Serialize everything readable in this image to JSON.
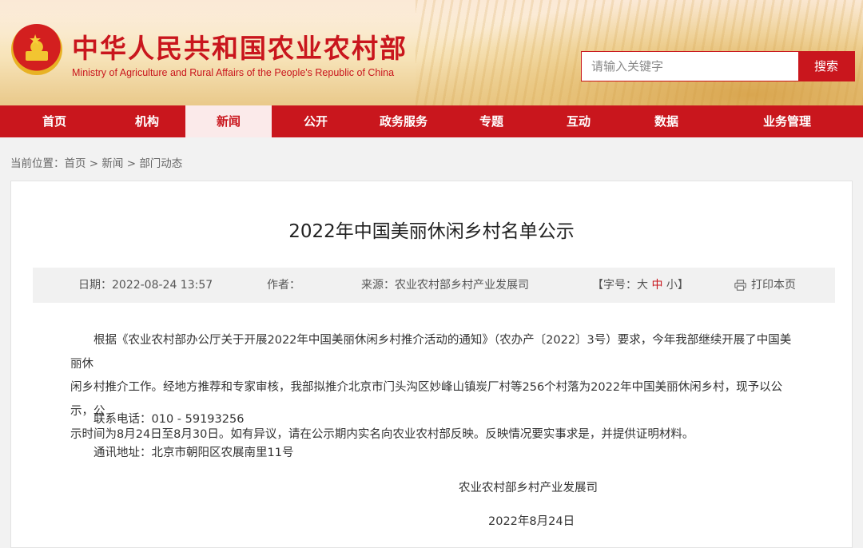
{
  "header": {
    "title_zh": "中华人民共和国农业农村部",
    "title_en": "Ministry of Agriculture and Rural Affairs of the People's Republic of China",
    "search_placeholder": "请输入关键字",
    "search_button": "搜索"
  },
  "nav": [
    {
      "label": "首页",
      "active": false
    },
    {
      "label": "机构",
      "active": false
    },
    {
      "label": "新闻",
      "active": true
    },
    {
      "label": "公开",
      "active": false
    },
    {
      "label": "政务服务",
      "active": false
    },
    {
      "label": "专题",
      "active": false
    },
    {
      "label": "互动",
      "active": false
    },
    {
      "label": "数据",
      "active": false
    },
    {
      "label": "业务管理",
      "active": false
    }
  ],
  "breadcrumb": {
    "prefix": "当前位置：",
    "items": [
      "首页",
      "新闻",
      "部门动态"
    ],
    "sep": " > "
  },
  "article": {
    "title": "2022年中国美丽休闲乡村名单公示",
    "date": "日期：2022-08-24 13:57",
    "author": "作者：",
    "source": "来源：农业农村部乡村产业发展司",
    "font_size_prefix": "【字号：",
    "font_size_large": "大",
    "font_size_medium": "中",
    "font_size_small": "小",
    "font_size_suffix": "】",
    "print": "打印本页",
    "body_lines": [
      "根据《农业农村部办公厅关于开展2022年中国美丽休闲乡村推介活动的通知》（农办产〔2022〕3号）要求，今年我部继续开展了中国美丽休",
      "闲乡村推介工作。经地方推荐和专家审核，我部拟推介北京市门头沟区妙峰山镇炭厂村等256个村落为2022年中国美丽休闲乡村，现予以公示，公",
      "示时间为8月24日至8月30日。如有异议，请在公示期内实名向农业农村部反映。反映情况要实事求是，并提供证明材料。"
    ],
    "phone": "联系电话：010 - 59193256",
    "address": "通讯地址：北京市朝阳区农展南里11号",
    "signature": "农业农村部乡村产业发展司",
    "sign_date": "2022年8月24日"
  },
  "colors": {
    "brand_red": "#c9161d",
    "active_tab_bg": "#fbeaea"
  }
}
